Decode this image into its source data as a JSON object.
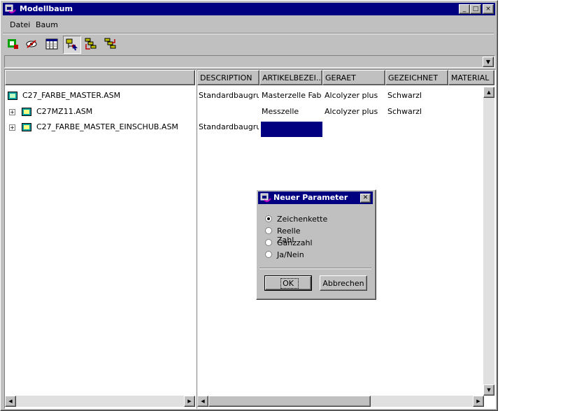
{
  "window": {
    "title": "Modellbaum",
    "controls": [
      "_",
      "□",
      "×"
    ]
  },
  "menu": [
    {
      "label": "Datei"
    },
    {
      "label": "Baum"
    }
  ],
  "toolbar": [
    {
      "icon": "tree-settings-icon"
    },
    {
      "icon": "hide-icon"
    },
    {
      "icon": "columns-icon"
    },
    {
      "icon": "select-tree-icon"
    },
    {
      "icon": "expand-tree-icon"
    },
    {
      "icon": "collapse-tree-icon"
    }
  ],
  "combo": {
    "value": ""
  },
  "tree": {
    "items": [
      {
        "label": "C27_FARBE_MASTER.ASM",
        "expandable": false
      },
      {
        "label": "C27MZ11.ASM",
        "expandable": true
      },
      {
        "label": "C27_FARBE_MASTER_EINSCHUB.ASM",
        "expandable": true
      }
    ]
  },
  "columns": [
    {
      "label": "DESCRIPTION"
    },
    {
      "label": "ARTIKELBEZEI..."
    },
    {
      "label": "GERAET"
    },
    {
      "label": "GEZEICHNET"
    },
    {
      "label": "MATERIAL"
    }
  ],
  "rows": [
    {
      "cells": [
        "Standardbaugru...",
        "Masterzelle Fabe",
        "Alcolyzer plus",
        "Schwarzl"
      ]
    },
    {
      "cells": [
        "",
        "Messzelle",
        "Alcolyzer plus",
        "Schwarzl"
      ]
    },
    {
      "cells": [
        "Standardbaugru...",
        "",
        "",
        ""
      ]
    }
  ],
  "dialog": {
    "title": "Neuer Parameter",
    "options": [
      {
        "label": "Zeichenkette",
        "selected": true
      },
      {
        "label": "Reelle Zahl",
        "selected": false
      },
      {
        "label": "Ganzzahl",
        "selected": false
      },
      {
        "label": "Ja/Nein",
        "selected": false
      }
    ],
    "ok_label": "OK",
    "cancel_label": "Abbrechen"
  },
  "colors": {
    "titlebar": "#000080",
    "selection": "#000080",
    "face": "#c0c0c0"
  }
}
